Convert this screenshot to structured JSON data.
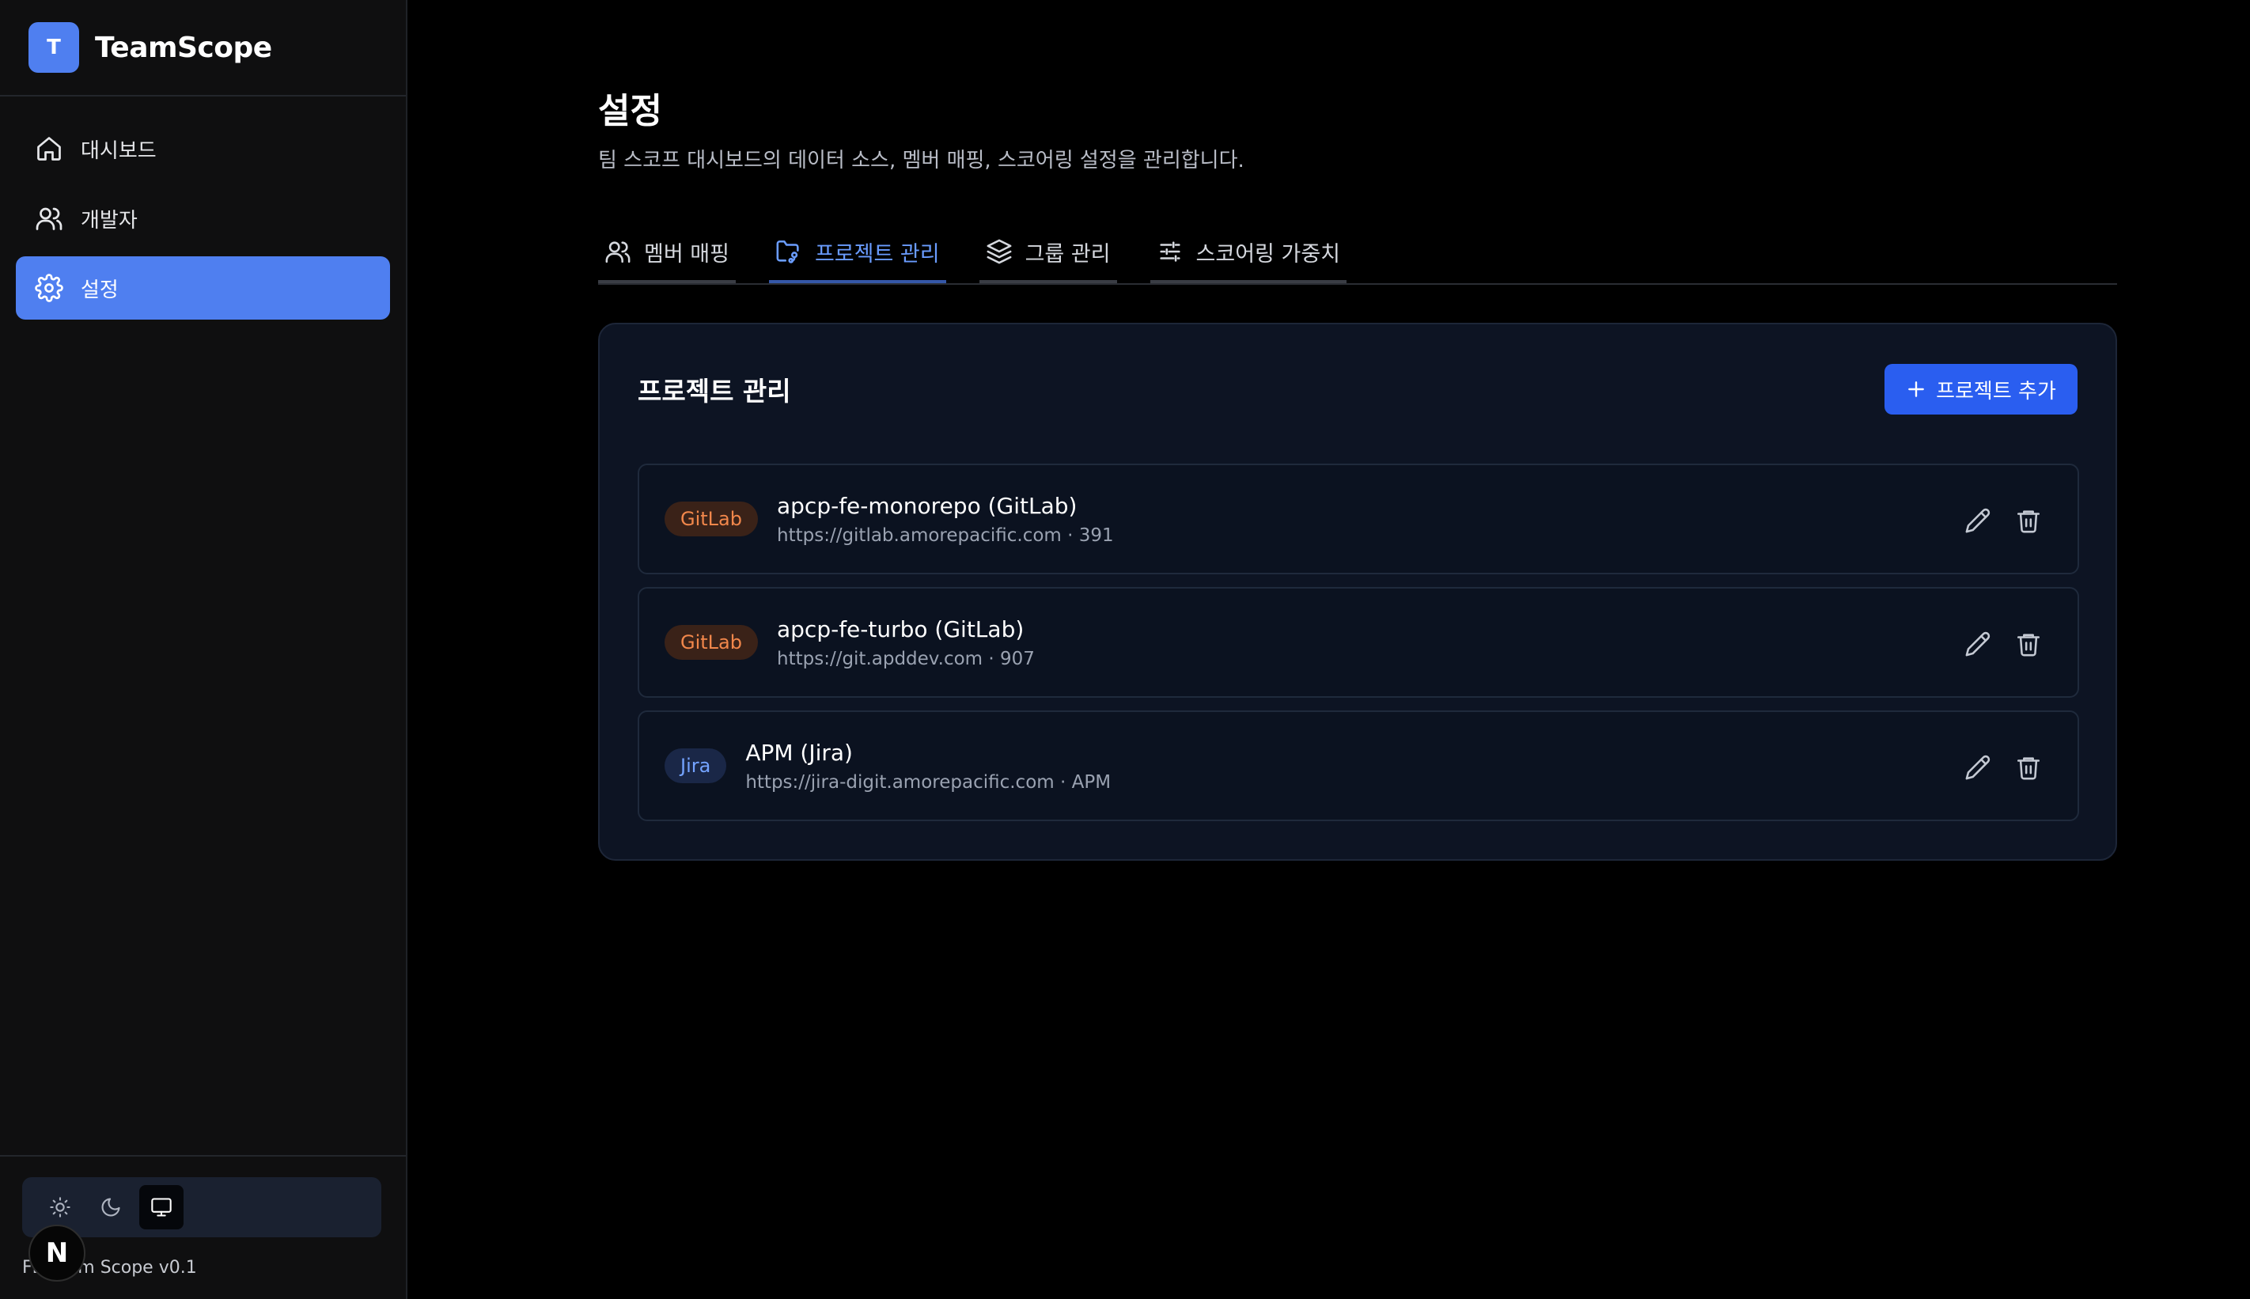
{
  "brand": {
    "logo_letter": "T",
    "name": "TeamScope"
  },
  "sidebar": {
    "items": [
      {
        "label": "대시보드",
        "icon": "home-icon",
        "active": false
      },
      {
        "label": "개발자",
        "icon": "users-icon",
        "active": false
      },
      {
        "label": "설정",
        "icon": "gear-icon",
        "active": true
      }
    ],
    "theme_options": [
      "light",
      "dark",
      "system"
    ],
    "theme_selected": "system",
    "version": "FE Team Scope v0.1",
    "n_badge": "N"
  },
  "page": {
    "title": "설정",
    "subtitle": "팀 스코프 대시보드의 데이터 소스, 멤버 매핑, 스코어링 설정을 관리합니다."
  },
  "tabs": [
    {
      "label": "멤버 매핑",
      "icon": "users-icon",
      "active": false
    },
    {
      "label": "프로젝트 관리",
      "icon": "folder-git-icon",
      "active": true
    },
    {
      "label": "그룹 관리",
      "icon": "layers-icon",
      "active": false
    },
    {
      "label": "스코어링 가중치",
      "icon": "sliders-icon",
      "active": false
    }
  ],
  "card": {
    "title": "프로젝트 관리",
    "add_button": "프로젝트 추가"
  },
  "projects": [
    {
      "badge": "GitLab",
      "name": "apcp-fe-monorepo (GitLab)",
      "meta": "https://gitlab.amorepacific.com · 391"
    },
    {
      "badge": "GitLab",
      "name": "apcp-fe-turbo (GitLab)",
      "meta": "https://git.apddev.com · 907"
    },
    {
      "badge": "Jira",
      "name": "APM (Jira)",
      "meta": "https://jira-digit.amorepacific.com · APM"
    }
  ],
  "colors": {
    "accent": "#4f7ff0",
    "primary_button": "#2a5ef0",
    "gitlab_badge": "#f1874b",
    "jira_badge": "#74a3ff"
  }
}
